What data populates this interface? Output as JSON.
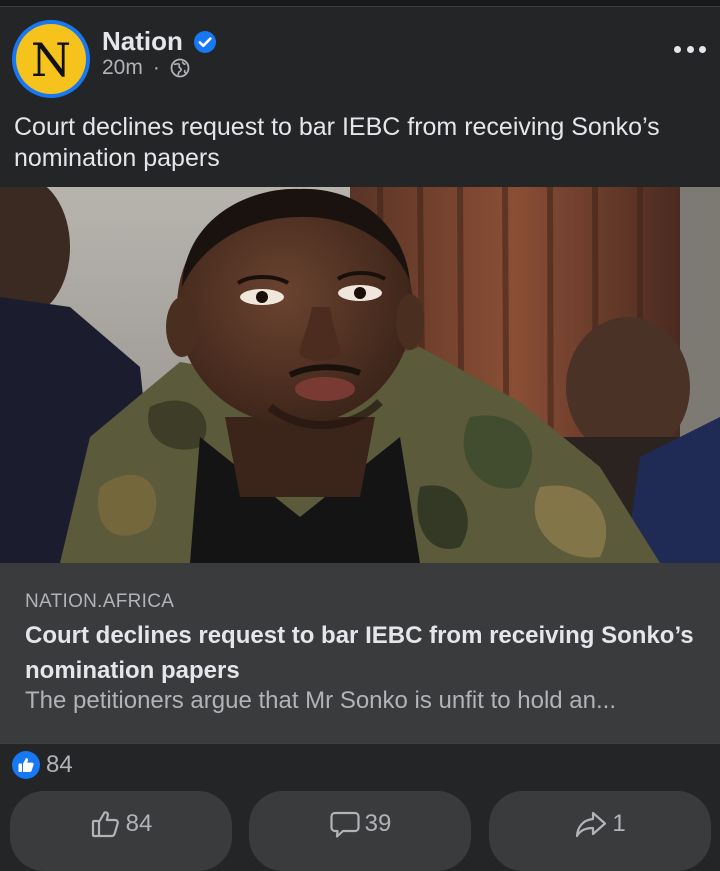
{
  "post": {
    "author": "Nation",
    "avatar_letter": "N",
    "time": "20m",
    "separator": "·",
    "privacy_icon": "globe-icon",
    "verified_icon": "verified-badge-icon",
    "text": "Court declines request to bar IEBC from receiving Sonko’s nomination papers"
  },
  "link": {
    "domain": "NATION.AFRICA",
    "title": "Court declines request to bar IEBC from receiving Sonko’s nomination papers",
    "description": "The petitioners argue that Mr Sonko is unfit to hold an..."
  },
  "reactions": {
    "icon": "like-reaction-icon",
    "count": "84"
  },
  "actions": {
    "like": {
      "icon": "thumbs-up-icon",
      "count": "84"
    },
    "comment": {
      "icon": "comment-bubble-icon",
      "count": "39"
    },
    "share": {
      "icon": "share-arrow-icon",
      "count": "1"
    }
  },
  "colors": {
    "background": "#242526",
    "link_box": "#3a3b3c",
    "accent": "#1877f2",
    "avatar_fill": "#f6c21c",
    "primary_text": "#e4e6eb",
    "secondary_text": "#b0b3b8"
  }
}
